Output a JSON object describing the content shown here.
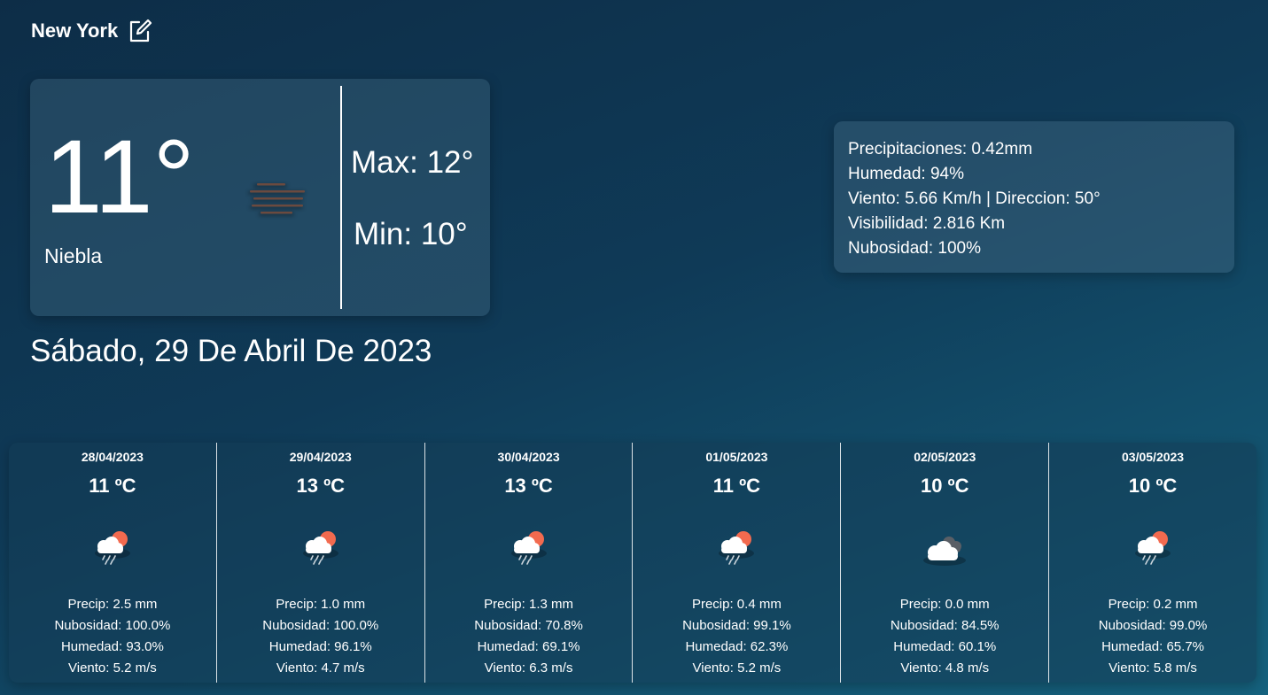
{
  "header": {
    "city": "New York"
  },
  "current": {
    "temperature": "11°",
    "condition": "Niebla",
    "max": "Max: 12°",
    "min": "Min: 10°",
    "icon": "fog-icon"
  },
  "date": "Sábado, 29 De Abril De 2023",
  "details": {
    "precip": "Precipitaciones: 0.42mm",
    "humidity": "Humedad: 94%",
    "wind": "Viento: 5.66 Km/h | Direccion: 50°",
    "visibility": "Visibilidad: 2.816 Km",
    "cloud": "Nubosidad: 100%"
  },
  "forecast": [
    {
      "date": "28/04/2023",
      "temp": "11 ºC",
      "icon": "sun-cloud-rain-icon",
      "precip": "Precip: 2.5 mm",
      "cloud": "Nubosidad: 100.0%",
      "humidity": "Humedad: 93.0%",
      "wind": "Viento: 5.2 m/s"
    },
    {
      "date": "29/04/2023",
      "temp": "13 ºC",
      "icon": "sun-cloud-rain-icon",
      "precip": "Precip: 1.0 mm",
      "cloud": "Nubosidad: 100.0%",
      "humidity": "Humedad: 96.1%",
      "wind": "Viento: 4.7 m/s"
    },
    {
      "date": "30/04/2023",
      "temp": "13 ºC",
      "icon": "sun-cloud-rain-icon",
      "precip": "Precip: 1.3 mm",
      "cloud": "Nubosidad: 70.8%",
      "humidity": "Humedad: 69.1%",
      "wind": "Viento: 6.3 m/s"
    },
    {
      "date": "01/05/2023",
      "temp": "11 ºC",
      "icon": "sun-cloud-rain-icon",
      "precip": "Precip: 0.4 mm",
      "cloud": "Nubosidad: 99.1%",
      "humidity": "Humedad: 62.3%",
      "wind": "Viento: 5.2 m/s"
    },
    {
      "date": "02/05/2023",
      "temp": "10 ºC",
      "icon": "cloudy-icon",
      "precip": "Precip: 0.0 mm",
      "cloud": "Nubosidad: 84.5%",
      "humidity": "Humedad: 60.1%",
      "wind": "Viento: 4.8 m/s"
    },
    {
      "date": "03/05/2023",
      "temp": "10 ºC",
      "icon": "sun-cloud-rain-icon",
      "precip": "Precip: 0.2 mm",
      "cloud": "Nubosidad: 99.0%",
      "humidity": "Humedad: 65.7%",
      "wind": "Viento: 5.8 m/s"
    }
  ],
  "colors": {
    "background_top": "#0d2d47",
    "background_bottom": "#15627e",
    "sun": "#f26a4f",
    "fog": "#6b4a3f"
  }
}
